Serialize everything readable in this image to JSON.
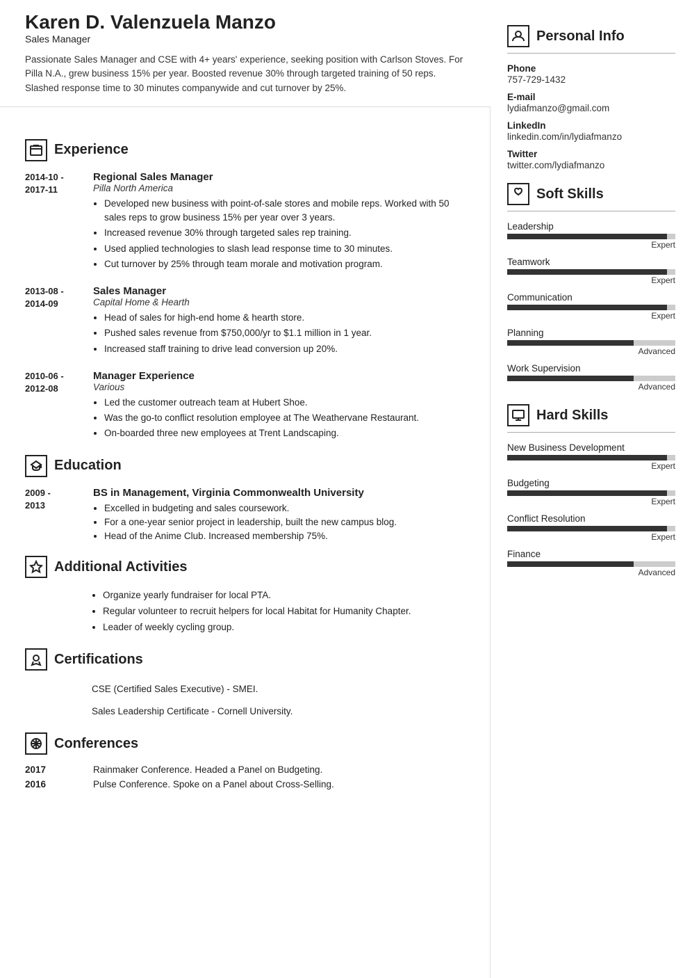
{
  "header": {
    "name": "Karen D. Valenzuela Manzo",
    "title": "Sales Manager",
    "summary": "Passionate Sales Manager and CSE with 4+ years' experience, seeking position with Carlson Stoves. For Pilla N.A., grew business 15% per year. Boosted revenue 30% through targeted training of 50 reps. Slashed response time to 30 minutes companywide and cut turnover by 25%."
  },
  "sections": {
    "experience": {
      "title": "Experience",
      "items": [
        {
          "dates": "2014-10 - 2017-11",
          "role": "Regional Sales Manager",
          "company": "Pilla North America",
          "bullets": [
            "Developed new business with point-of-sale stores and mobile reps. Worked with 50 sales reps to grow business 15% per year over 3 years.",
            "Increased revenue 30% through targeted sales rep training.",
            "Used applied technologies to slash lead response time to 30 minutes.",
            "Cut turnover by 25% through team morale and motivation program."
          ]
        },
        {
          "dates": "2013-08 - 2014-09",
          "role": "Sales Manager",
          "company": "Capital Home & Hearth",
          "bullets": [
            "Head of sales for high-end home & hearth store.",
            "Pushed sales revenue from $750,000/yr to $1.1 million in 1 year.",
            "Increased staff training to drive lead conversion up 20%."
          ]
        },
        {
          "dates": "2010-06 - 2012-08",
          "role": "Manager Experience",
          "company": "Various",
          "bullets": [
            "Led the customer outreach team at Hubert Shoe.",
            "Was the go-to conflict resolution employee at The Weathervane Restaurant.",
            "On-boarded three new employees at Trent Landscaping."
          ]
        }
      ]
    },
    "education": {
      "title": "Education",
      "items": [
        {
          "dates": "2009 - 2013",
          "degree": "BS in Management, Virginia Commonwealth University",
          "bullets": [
            "Excelled in budgeting and sales coursework.",
            "For a one-year senior project in leadership, built the new campus blog.",
            "Head of the Anime Club. Increased membership 75%."
          ]
        }
      ]
    },
    "activities": {
      "title": "Additional Activities",
      "items": [
        "Organize yearly fundraiser for local PTA.",
        "Regular volunteer to recruit helpers for local Habitat for Humanity Chapter.",
        "Leader of weekly cycling group."
      ]
    },
    "certifications": {
      "title": "Certifications",
      "items": [
        "CSE (Certified Sales Executive) - SMEI.",
        "Sales Leadership Certificate - Cornell University."
      ]
    },
    "conferences": {
      "title": "Conferences",
      "items": [
        {
          "year": "2017",
          "text": "Rainmaker Conference. Headed a Panel on Budgeting."
        },
        {
          "year": "2016",
          "text": "Pulse Conference. Spoke on a Panel about Cross-Selling."
        }
      ]
    }
  },
  "sidebar": {
    "personal_info": {
      "title": "Personal Info",
      "fields": [
        {
          "label": "Phone",
          "value": "757-729-1432"
        },
        {
          "label": "E-mail",
          "value": "lydiafmanzo@gmail.com"
        },
        {
          "label": "LinkedIn",
          "value": "linkedin.com/in/lydiafmanzo"
        },
        {
          "label": "Twitter",
          "value": "twitter.com/lydiafmanzo"
        }
      ]
    },
    "soft_skills": {
      "title": "Soft Skills",
      "items": [
        {
          "name": "Leadership",
          "level": "Expert",
          "pct": 95
        },
        {
          "name": "Teamwork",
          "level": "Expert",
          "pct": 95
        },
        {
          "name": "Communication",
          "level": "Expert",
          "pct": 95
        },
        {
          "name": "Planning",
          "level": "Advanced",
          "pct": 75
        },
        {
          "name": "Work Supervision",
          "level": "Advanced",
          "pct": 75
        }
      ]
    },
    "hard_skills": {
      "title": "Hard Skills",
      "items": [
        {
          "name": "New Business Development",
          "level": "Expert",
          "pct": 95
        },
        {
          "name": "Budgeting",
          "level": "Expert",
          "pct": 95
        },
        {
          "name": "Conflict Resolution",
          "level": "Expert",
          "pct": 95
        },
        {
          "name": "Finance",
          "level": "Advanced",
          "pct": 75
        }
      ]
    }
  }
}
